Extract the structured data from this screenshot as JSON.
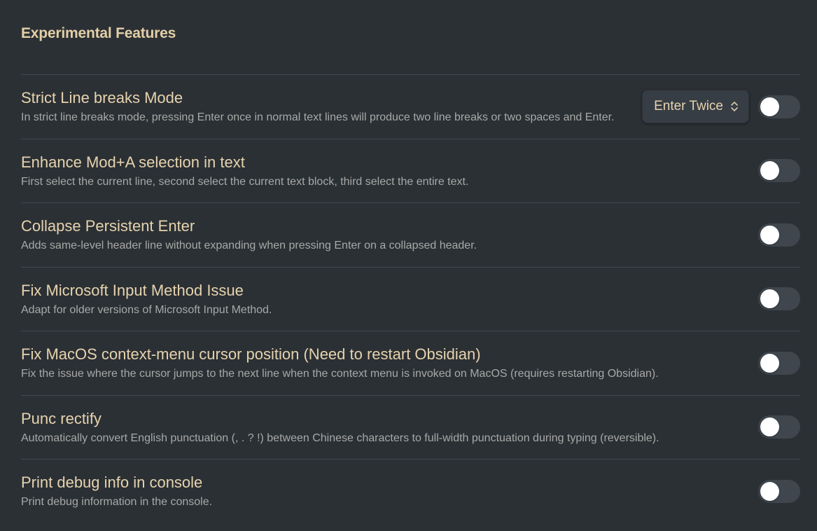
{
  "section": {
    "title": "Experimental Features"
  },
  "settings": [
    {
      "name": "Strict Line breaks Mode",
      "description": "In strict line breaks mode, pressing Enter once in normal text lines will produce two line breaks or two spaces and Enter.",
      "dropdown_value": "Enter Twice",
      "enabled": false
    },
    {
      "name": "Enhance Mod+A selection in text",
      "description": "First select the current line, second select the current text block, third select the entire text.",
      "enabled": false
    },
    {
      "name": "Collapse Persistent Enter",
      "description": "Adds same-level header line without expanding when pressing Enter on a collapsed header.",
      "enabled": false
    },
    {
      "name": "Fix Microsoft Input Method Issue",
      "description": "Adapt for older versions of Microsoft Input Method.",
      "enabled": false
    },
    {
      "name": "Fix MacOS context-menu cursor position (Need to restart Obsidian)",
      "description": "Fix the issue where the cursor jumps to the next line when the context menu is invoked on MacOS (requires restarting Obsidian).",
      "enabled": false
    },
    {
      "name": "Punc rectify",
      "description": "Automatically convert English punctuation (, . ? !) between Chinese characters to full-width punctuation during typing (reversible).",
      "enabled": false
    },
    {
      "name": "Print debug info in console",
      "description": "Print debug information in the console.",
      "enabled": false
    }
  ],
  "icons": {
    "dropdown": "chevron-up-down-icon"
  },
  "colors": {
    "background": "#2b3035",
    "heading": "#e3cfa6",
    "setting_name": "#e6d3ad",
    "description": "#a8a9a6",
    "toggle_off": "#3f464d",
    "divider": "#41474e"
  }
}
